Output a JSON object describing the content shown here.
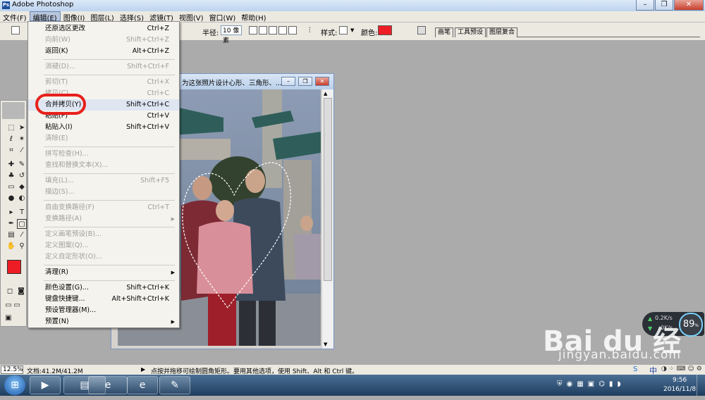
{
  "app": {
    "title": "Adobe Photoshop",
    "logo_text": "Ps"
  },
  "window_controls": {
    "minimize": "–",
    "restore": "❐",
    "close": "✕"
  },
  "menubar": [
    {
      "label": "文件(F)"
    },
    {
      "label": "编辑(E)"
    },
    {
      "label": "图像(I)"
    },
    {
      "label": "图层(L)"
    },
    {
      "label": "选择(S)"
    },
    {
      "label": "滤镜(T)"
    },
    {
      "label": "视图(V)"
    },
    {
      "label": "窗口(W)"
    },
    {
      "label": "帮助(H)"
    }
  ],
  "optionsbar": {
    "radius_label": "半径:",
    "radius_value": "10 像素",
    "style_label": "样式:",
    "color_label": "颜色:",
    "color_swatch": "#ee1c24",
    "palette_tabs": [
      "画笔",
      "工具预设",
      "图层复合"
    ]
  },
  "edit_menu": {
    "items": [
      {
        "label": "还原选区更改",
        "shortcut": "Ctrl+Z",
        "enabled": true
      },
      {
        "label": "向前(W)",
        "shortcut": "Shift+Ctrl+Z",
        "enabled": false
      },
      {
        "label": "返回(K)",
        "shortcut": "Alt+Ctrl+Z",
        "enabled": true
      },
      {
        "label": "消褪(D)...",
        "shortcut": "Shift+Ctrl+F",
        "enabled": false
      },
      {
        "label": "剪切(T)",
        "shortcut": "Ctrl+X",
        "enabled": false
      },
      {
        "label": "拷贝(C)",
        "shortcut": "Ctrl+C",
        "enabled": false
      },
      {
        "label": "合并拷贝(Y)",
        "shortcut": "Shift+Ctrl+C",
        "enabled": true
      },
      {
        "label": "粘贴(P)",
        "shortcut": "Ctrl+V",
        "enabled": true
      },
      {
        "label": "粘贴入(I)",
        "shortcut": "Shift+Ctrl+V",
        "enabled": true
      },
      {
        "label": "清除(E)",
        "shortcut": "",
        "enabled": false
      },
      {
        "label": "拼写检查(H)...",
        "shortcut": "",
        "enabled": false
      },
      {
        "label": "查找和替换文本(X)...",
        "shortcut": "",
        "enabled": false
      },
      {
        "label": "填充(L)...",
        "shortcut": "Shift+F5",
        "enabled": false
      },
      {
        "label": "描边(S)...",
        "shortcut": "",
        "enabled": false
      },
      {
        "label": "自由变换路径(F)",
        "shortcut": "Ctrl+T",
        "enabled": false
      },
      {
        "label": "变换路径(A)",
        "shortcut": "",
        "enabled": false
      },
      {
        "label": "定义画笔预设(B)...",
        "shortcut": "",
        "enabled": false
      },
      {
        "label": "定义图案(Q)...",
        "shortcut": "",
        "enabled": false
      },
      {
        "label": "定义自定形状(O)...",
        "shortcut": "",
        "enabled": false
      },
      {
        "label": "清理(R)",
        "shortcut": "",
        "enabled": true
      },
      {
        "label": "颜色设置(G)...",
        "shortcut": "Shift+Ctrl+K",
        "enabled": true
      },
      {
        "label": "键盘快捷键...",
        "shortcut": "Alt+Shift+Ctrl+K",
        "enabled": true
      },
      {
        "label": "预设管理器(M)...",
        "shortcut": "",
        "enabled": true
      },
      {
        "label": "预置(N)",
        "shortcut": "",
        "enabled": true
      }
    ],
    "submenu_arrow": "▶"
  },
  "document": {
    "title": "为这张照片设计心形、三角形、..."
  },
  "statusbar": {
    "zoom": "12.5%",
    "doc_size": "文档:41.2M/41.2M",
    "hint": "点按并拖移可绘制圆角矩形。要用其他选项，使用 Shift、Alt 和 Ctrl 键。"
  },
  "net_widget": {
    "upload": "0.2K/s",
    "download": "0K/s",
    "percent": "89",
    "percent_unit": "%"
  },
  "watermark": {
    "main": "Bai du 经验",
    "sub": "jingyan.baidu.com"
  },
  "tray": {
    "ime": "中",
    "time": "9:56",
    "date": "2016/11/8"
  }
}
